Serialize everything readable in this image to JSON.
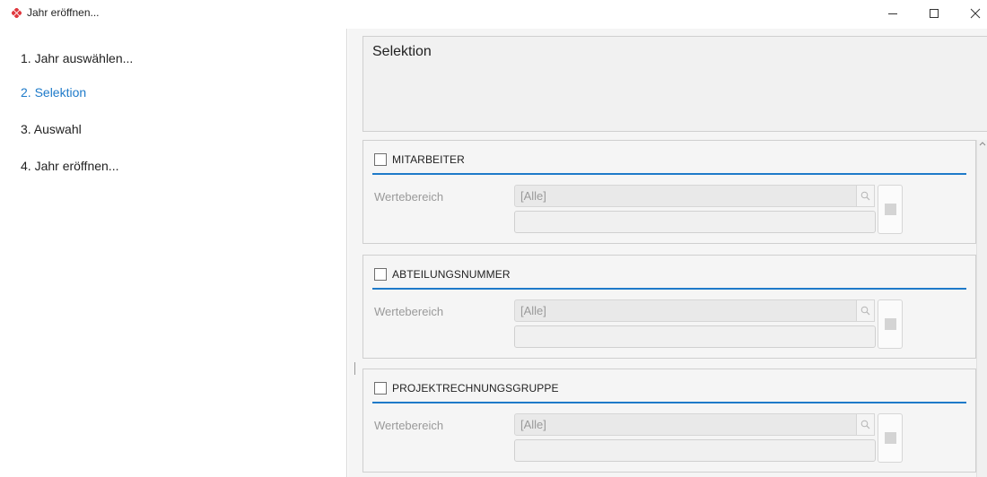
{
  "window": {
    "title": "Jahr eröffnen...",
    "controls": [
      "minimize-icon",
      "maximize-icon",
      "close-icon"
    ]
  },
  "nav": {
    "items": [
      {
        "label": "1. Jahr auswählen...",
        "active": false
      },
      {
        "label": "2. Selektion",
        "active": true
      },
      {
        "label": "3. Auswahl",
        "active": false
      },
      {
        "label": "4. Jahr eröffnen...",
        "active": false
      }
    ]
  },
  "selection": {
    "title": "Selektion"
  },
  "groups": [
    {
      "title": "MITARBEITER",
      "checked": false,
      "field_label": "Wertebereich",
      "value": "[Alle]"
    },
    {
      "title": "ABTEILUNGSNUMMER",
      "checked": false,
      "field_label": "Wertebereich",
      "value": "[Alle]"
    },
    {
      "title": "PROJEKTRECHNUNGSGRUPPE",
      "checked": false,
      "field_label": "Wertebereich",
      "value": "[Alle]"
    }
  ],
  "colors": {
    "accent": "#1e7ac9",
    "logo": "#e0383e"
  }
}
